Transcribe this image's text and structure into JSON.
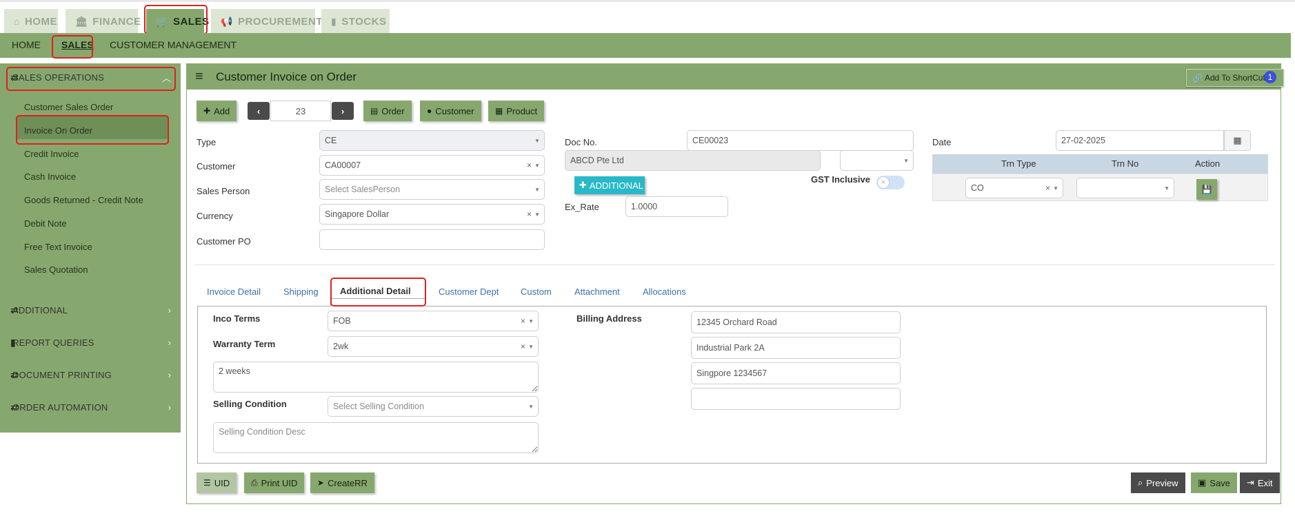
{
  "top_tabs": [
    {
      "label": "HOME",
      "icon": "home-icon"
    },
    {
      "label": "FINANCE",
      "icon": "bank-icon"
    },
    {
      "label": "SALES",
      "icon": "cart-icon"
    },
    {
      "label": "PROCUREMENT",
      "icon": "megaphone-icon"
    },
    {
      "label": "STOCKS",
      "icon": "bar-chart-icon"
    }
  ],
  "sub_nav": [
    "HOME",
    "SALES",
    "CUSTOMER MANAGEMENT"
  ],
  "sidebar": {
    "sales_operations": "SALES OPERATIONS",
    "items": [
      "Customer Sales Order",
      "Invoice On Order",
      "Credit Invoice",
      "Cash Invoice",
      "Goods Returned - Credit Note",
      "Debit Note",
      "Free Text Invoice",
      "Sales Quotation"
    ],
    "sections": [
      "ADDITIONAL",
      "REPORT QUERIES",
      "DOCUMENT PRINTING",
      "ORDER AUTOMATION"
    ]
  },
  "header": {
    "title": "Customer Invoice on Order",
    "shortcut_label": "Add To ShortCut",
    "shortcut_badge": "1"
  },
  "toolbar": {
    "add": "Add",
    "page_number": "23",
    "order": "Order",
    "customer": "Customer",
    "product": "Product"
  },
  "form": {
    "type_label": "Type",
    "type_value": "CE",
    "customer_label": "Customer",
    "customer_value": "CA00007",
    "sales_person_label": "Sales Person",
    "sales_person_placeholder": "Select SalesPerson",
    "currency_label": "Currency",
    "currency_value": "Singapore Dollar",
    "customer_po_label": "Customer PO",
    "customer_po_value": "",
    "doc_no_label": "Doc No.",
    "doc_no_value": "CE00023",
    "customer_name": "ABCD Pte Ltd",
    "additional_button": "ADDITIONAL",
    "gst_inclusive_label": "GST Inclusive",
    "gst_inclusive": false,
    "ex_rate_label": "Ex_Rate",
    "ex_rate_value": "1.0000",
    "date_label": "Date",
    "date_value": "27-02-2025"
  },
  "trn_table": {
    "headers": [
      "Trn Type",
      "Trn No",
      "Action"
    ],
    "trn_type_value": "CO",
    "trn_no_value": ""
  },
  "tabs": [
    "Invoice Detail",
    "Shipping",
    "Additional Detail",
    "Customer Dept",
    "Custom",
    "Attachment",
    "Allocations"
  ],
  "active_tab": "Additional Detail",
  "additional_detail": {
    "inco_terms_label": "Inco Terms",
    "inco_terms_value": "FOB",
    "warranty_term_label": "Warranty Term",
    "warranty_term_value": "2wk",
    "warranty_desc": "2 weeks",
    "selling_condition_label": "Selling Condition",
    "selling_condition_placeholder": "Select Selling Condition",
    "selling_condition_desc_placeholder": "Selling Condition Desc",
    "billing_address_label": "Billing Address",
    "billing_address": [
      "12345 Orchard Road",
      "Industrial Park 2A",
      "Singpore 1234567",
      ""
    ]
  },
  "footer": {
    "uid": "UID",
    "print_uid": "Print UID",
    "create_rr": "CreateRR",
    "preview": "Preview",
    "save": "Save",
    "exit": "Exit"
  },
  "colors": {
    "accent_green": "#86a86e",
    "highlight_red": "#e0201e",
    "additional_teal": "#28b9c9",
    "dark_button": "#4a4a4a",
    "badge_blue": "#3a52d6"
  }
}
